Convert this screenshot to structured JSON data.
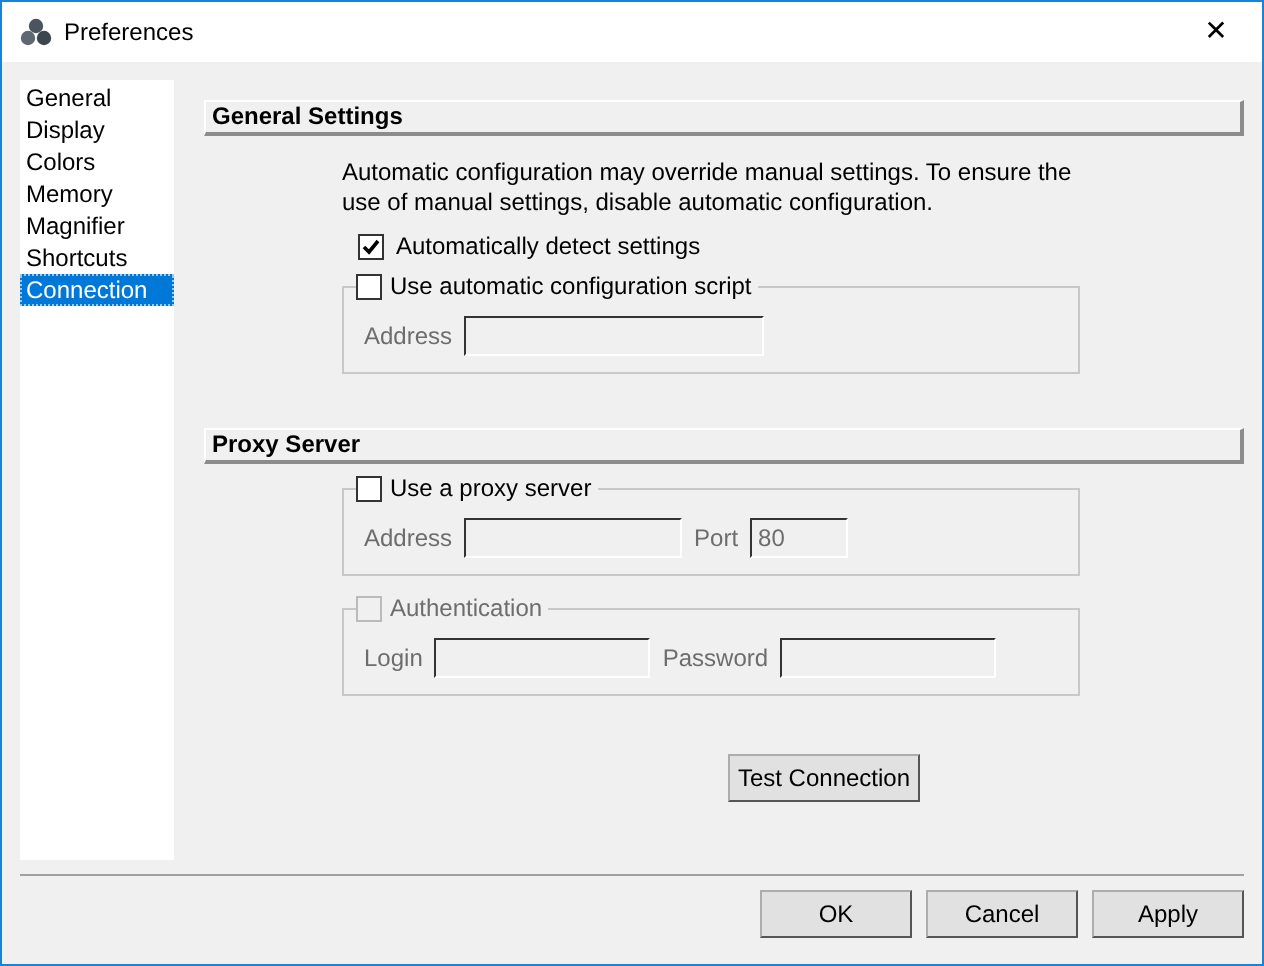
{
  "window": {
    "title": "Preferences",
    "close": "✕"
  },
  "sidebar": {
    "items": [
      {
        "label": "General",
        "selected": false
      },
      {
        "label": "Display",
        "selected": false
      },
      {
        "label": "Colors",
        "selected": false
      },
      {
        "label": "Memory",
        "selected": false
      },
      {
        "label": "Magnifier",
        "selected": false
      },
      {
        "label": "Shortcuts",
        "selected": false
      },
      {
        "label": "Connection",
        "selected": true
      }
    ]
  },
  "sections": [
    {
      "title": "General Settings",
      "description": "Automatic configuration may override manual settings. To ensure the use of manual settings, disable automatic configuration.",
      "options": [
        {
          "label": "Automatically detect settings",
          "checked": true
        }
      ],
      "groups": [
        {
          "label": "Use automatic configuration script",
          "checked": false,
          "disabled": false,
          "fields": [
            {
              "label": "Address",
              "disabled": true
            }
          ]
        }
      ]
    },
    {
      "title": "Proxy Server",
      "groups": [
        {
          "label": "Use a proxy server",
          "checked": false,
          "disabled": false,
          "fields": [
            {
              "label": "Address",
              "disabled": true
            },
            {
              "label": "Port",
              "value": "80",
              "disabled": true
            }
          ]
        },
        {
          "label": "Authentication",
          "checked": false,
          "disabled": true,
          "fields": [
            {
              "label": "Login",
              "disabled": true
            },
            {
              "label": "Password",
              "disabled": true
            }
          ]
        }
      ]
    }
  ],
  "test_button": "Test Connection",
  "buttons": [
    "OK",
    "Cancel",
    "Apply"
  ]
}
